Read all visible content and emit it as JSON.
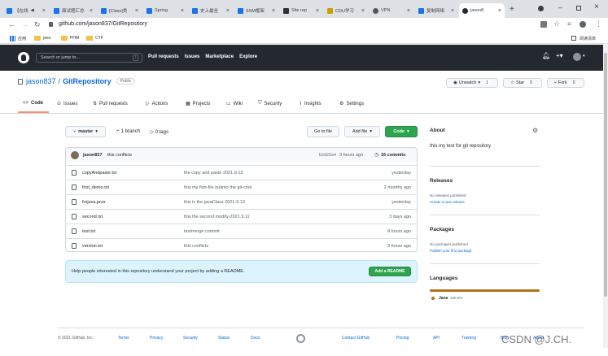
{
  "browser": {
    "tabs": [
      {
        "label": "【在线",
        "color": "#1a73e8"
      },
      {
        "label": "面试题汇总",
        "color": "#1a73e8"
      },
      {
        "label": "[Class]类",
        "color": "#1a73e8"
      },
      {
        "label": "Spring",
        "color": "#1a73e8"
      },
      {
        "label": "史上最全",
        "color": "#1a73e8"
      },
      {
        "label": "SSM框架",
        "color": "#1a73e8"
      },
      {
        "label": "Site rep",
        "color": "#2f2f2f"
      },
      {
        "label": "CDU学习",
        "color": "#c8a200"
      },
      {
        "label": "VPN",
        "color": "#555"
      },
      {
        "label": "复制网络",
        "color": "#1a73e8"
      },
      {
        "label": "jason8",
        "color": "#24292f"
      }
    ],
    "url": "github.com/jason837/GitRepository",
    "bookmarks": [
      "应用",
      "java",
      "PHM",
      "CTF"
    ],
    "reading_list": "阅读清单"
  },
  "gh_header": {
    "search_placeholder": "Search or jump to...",
    "search_key": "/",
    "nav": [
      "Pull requests",
      "Issues",
      "Marketplace",
      "Explore"
    ]
  },
  "repo": {
    "owner": "jason837",
    "sep": "/",
    "name": "GitRepository",
    "visibility": "Public",
    "unwatch": "Unwatch",
    "unwatch_count": "1",
    "star": "Star",
    "star_count": "0",
    "fork": "Fork",
    "fork_count": "0",
    "tabs": [
      "Code",
      "Issues",
      "Pull requests",
      "Actions",
      "Projects",
      "Wiki",
      "Security",
      "Insights",
      "Settings"
    ]
  },
  "filebar": {
    "branch": "master",
    "branches": "1 branch",
    "tags": "0 tags",
    "goto": "Go to file",
    "addfile": "Add file",
    "code": "Code"
  },
  "commit": {
    "author": "jason837",
    "message": "this conflicts",
    "hash": "b2d25a4",
    "time": "3 hours ago",
    "commits": "16 commits"
  },
  "files": [
    {
      "name": "copyAndpaste.txt",
      "msg": "the copy and paste 2021.9.13",
      "age": "yesterday"
    },
    {
      "name": "first_demo.txt",
      "msg": "this my first-file putinto the git-cool",
      "age": "2 months ago"
    },
    {
      "name": "forjava.java",
      "msg": "this is the javaClass 2021-9.13",
      "age": "yesterday"
    },
    {
      "name": "second.txt",
      "msg": "this the second modify-2021.9.11",
      "age": "3 days ago"
    },
    {
      "name": "test.txt",
      "msg": "testmerge commit",
      "age": "8 hours ago"
    },
    {
      "name": "version.txt",
      "msg": "this conflicts",
      "age": "3 hours ago"
    }
  ],
  "readme": {
    "text": "Help people interested in this repository understand your project by adding a README.",
    "button": "Add a README"
  },
  "sidebar": {
    "about": "About",
    "desc": "this my test for git repository",
    "releases": "Releases",
    "no_releases": "No releases published",
    "create_release": "Create a new release",
    "packages": "Packages",
    "no_packages": "No packages published",
    "publish_package": "Publish your first package",
    "languages": "Languages",
    "lang_name": "Java",
    "lang_pct": "100.0%",
    "lang_color": "#b07219"
  },
  "footer": {
    "copyright": "© 2021 GitHub, Inc.",
    "links_left": [
      "Terms",
      "Privacy",
      "Security",
      "Status",
      "Docs"
    ],
    "links_right": [
      "Contact GitHub",
      "Pricing",
      "API",
      "Training",
      "Blog",
      "About"
    ]
  },
  "watermark": "CSDN @J.CH."
}
